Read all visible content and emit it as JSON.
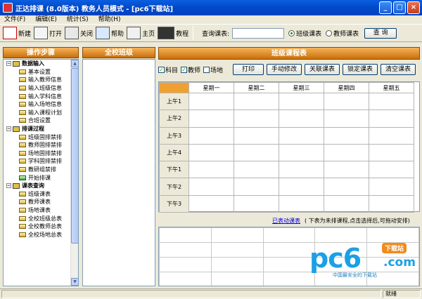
{
  "window": {
    "title": "正达排课 (8.0版本)  教务人员模式 - [pc6下载站]"
  },
  "menu": [
    "文件(F)",
    "编辑(E)",
    "统计(S)",
    "帮助(H)"
  ],
  "toolbar": {
    "buttons": [
      "新建",
      "打开",
      "关闭",
      "帮助",
      "主页",
      "教程"
    ],
    "search_label": "查询课表:",
    "search_value": "",
    "radio_class": "班级课表",
    "radio_teacher": "教师课表",
    "radio_selected": "班级课表",
    "query_button": "查 询"
  },
  "left_panel": {
    "header": "操作步骤",
    "groups": [
      {
        "label": "数据输入",
        "items": [
          "基本设置",
          "输入教师信息",
          "输入班级信息",
          "输入学科信息",
          "输入场地信息",
          "输入课程计划",
          "合班设置"
        ]
      },
      {
        "label": "排课过程",
        "items": [
          "班级固排禁排",
          "教师固排禁排",
          "场地固排禁排",
          "学科固排禁排",
          "教研组禁排",
          "开始排课"
        ]
      },
      {
        "label": "课表查询",
        "items": [
          "班级课表",
          "教师课表",
          "场地课表",
          "全校班级总表",
          "全校教师总表",
          "全校场地总表"
        ]
      }
    ]
  },
  "mid_panel": {
    "header": "全校班级"
  },
  "schedule": {
    "header": "班级课程表",
    "checkboxes": [
      {
        "label": "科目",
        "checked": true
      },
      {
        "label": "教师",
        "checked": true
      },
      {
        "label": "场地",
        "checked": false
      }
    ],
    "buttons": [
      "打印",
      "手动修改",
      "关联课表",
      "锁定课表",
      "清空课表"
    ],
    "days": [
      "星期一",
      "星期二",
      "星期三",
      "星期四",
      "星期五"
    ],
    "periods": [
      "上午1",
      "上午2",
      "上午3",
      "上午4",
      "下午1",
      "下午2",
      "下午3"
    ],
    "link_text": "已表动课表",
    "hint": "( 下表为未排课程,点击选择后,可拖动安排)"
  },
  "watermark": {
    "logo": "pc6",
    "com": ".com",
    "badge": "下载站",
    "slogan": "中国最安全的下载站"
  },
  "statusbar": {
    "text": "就绪"
  },
  "colors": {
    "titlebar": "#0148c8",
    "panel_header": "#e08a20",
    "corner": "#f0a030",
    "watermark": "#1aa0e6"
  }
}
